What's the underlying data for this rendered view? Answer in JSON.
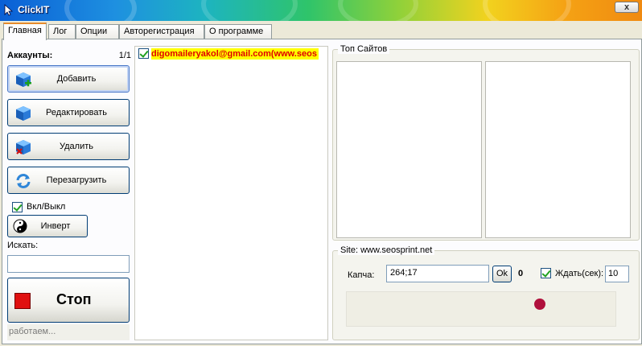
{
  "window": {
    "title": "ClickIT",
    "close_label": "x"
  },
  "tabs": [
    {
      "label": "Главная"
    },
    {
      "label": "Лог"
    },
    {
      "label": "Опции"
    },
    {
      "label": "Авторегистрация"
    },
    {
      "label": "О программе"
    }
  ],
  "accounts": {
    "label": "Аккаунты:",
    "count": "1/1",
    "list": [
      {
        "text": "digomaileryakol@gmail.com(www.seos",
        "checked": true
      }
    ]
  },
  "buttons": {
    "add": "Добавить",
    "edit": "Редактировать",
    "delete": "Удалить",
    "reload": "Перезагрузить",
    "invert": "Инверт",
    "stop": "Стоп"
  },
  "toggle": {
    "label": "Вкл/Выкл",
    "checked": true
  },
  "search": {
    "label": "Искать:",
    "value": ""
  },
  "status": "работаем...",
  "top_sites": {
    "title": "Топ Сайтов"
  },
  "site": {
    "title": "Site: www.seosprint.net",
    "captcha_label": "Капча:",
    "captcha_value": "264;17",
    "ok_label": "Ok",
    "counter": "0",
    "wait_label": "Ждать(сек):",
    "wait_checked": true,
    "wait_value": "10"
  },
  "colors": {
    "tab_accent": "#e68b2c",
    "stop_red": "#e01010",
    "captcha_dot": "#b0103c",
    "account_highlight": "#ffff00",
    "account_text": "#e00000"
  }
}
